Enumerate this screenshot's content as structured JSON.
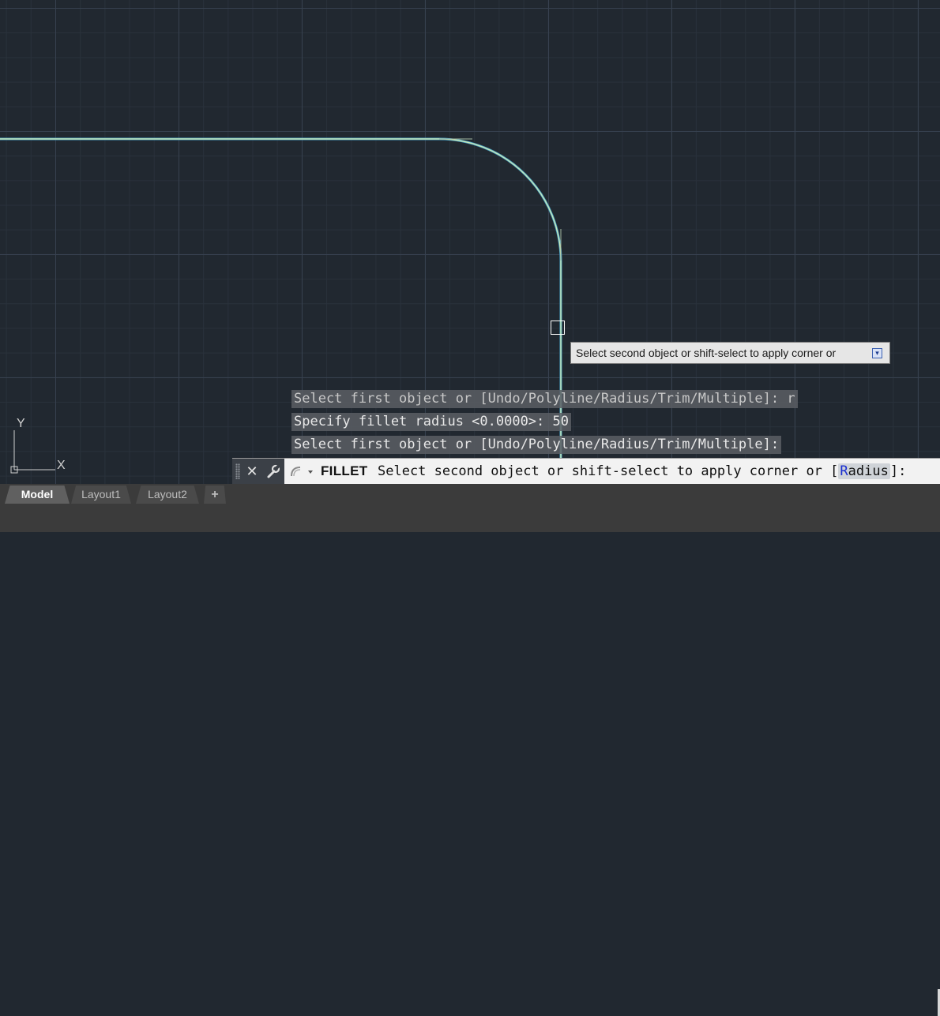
{
  "command_history": [
    "Select first object or [Undo/Polyline/Radius/Trim/Multiple]: r",
    "Specify fillet radius <0.0000>: 50",
    "Select first object or [Undo/Polyline/Radius/Trim/Multiple]:"
  ],
  "tooltip": {
    "text": "Select second object or shift-select to apply corner or",
    "expand_icon": "chevron-down-icon"
  },
  "ucs": {
    "x_label": "X",
    "y_label": "Y"
  },
  "command_line": {
    "command_name": "FILLET",
    "prompt_prefix": "Select second object or shift-select to apply corner or [",
    "option_hotkey": "R",
    "option_rest": "adius",
    "prompt_suffix": "]:",
    "close_icon": "close-icon",
    "customize_icon": "wrench-icon",
    "recent_icon": "recent-commands-icon"
  },
  "tabs": {
    "model": "Model",
    "layout1": "Layout1",
    "layout2": "Layout2",
    "add": "+"
  },
  "colors": {
    "canvas_bg": "#212830",
    "geometry": "#c7e8b8",
    "geometry_outer": "#4aa3c8"
  }
}
